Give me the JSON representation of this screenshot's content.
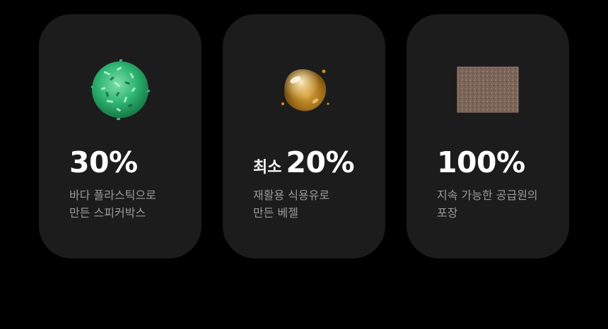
{
  "cards": [
    {
      "image_icon": "green-recycled-plastic-flakes-icon",
      "stat_prefix": "",
      "stat_value": "30%",
      "desc_lines": [
        "바다 플라스틱으로",
        "만든 스피커박스"
      ]
    },
    {
      "image_icon": "golden-gel-droplet-icon",
      "stat_prefix": "최소",
      "stat_value": "20%",
      "desc_lines": [
        "재활용 식용유로",
        "만든 베젤"
      ]
    },
    {
      "image_icon": "brown-paper-texture-icon",
      "stat_prefix": "",
      "stat_value": "100%",
      "desc_lines": [
        "지속 가능한 공급원의",
        "포장"
      ]
    }
  ],
  "colors": {
    "background": "#000000",
    "card": "#1c1c1c",
    "stat": "#ffffff",
    "description": "#9a9a9a"
  }
}
